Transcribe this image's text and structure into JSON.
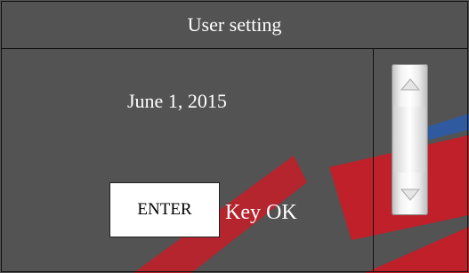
{
  "window": {
    "title": "User setting"
  },
  "main": {
    "date_text": "June 1, 2015",
    "enter_button_label": "ENTER",
    "key_status_text": "Key OK"
  },
  "scrollbar": {
    "up_icon": "triangle-up-icon",
    "down_icon": "triangle-down-icon"
  },
  "colors": {
    "background": "#535353",
    "watermark_red": "#c0202a",
    "watermark_blue": "#2f5aa0"
  }
}
